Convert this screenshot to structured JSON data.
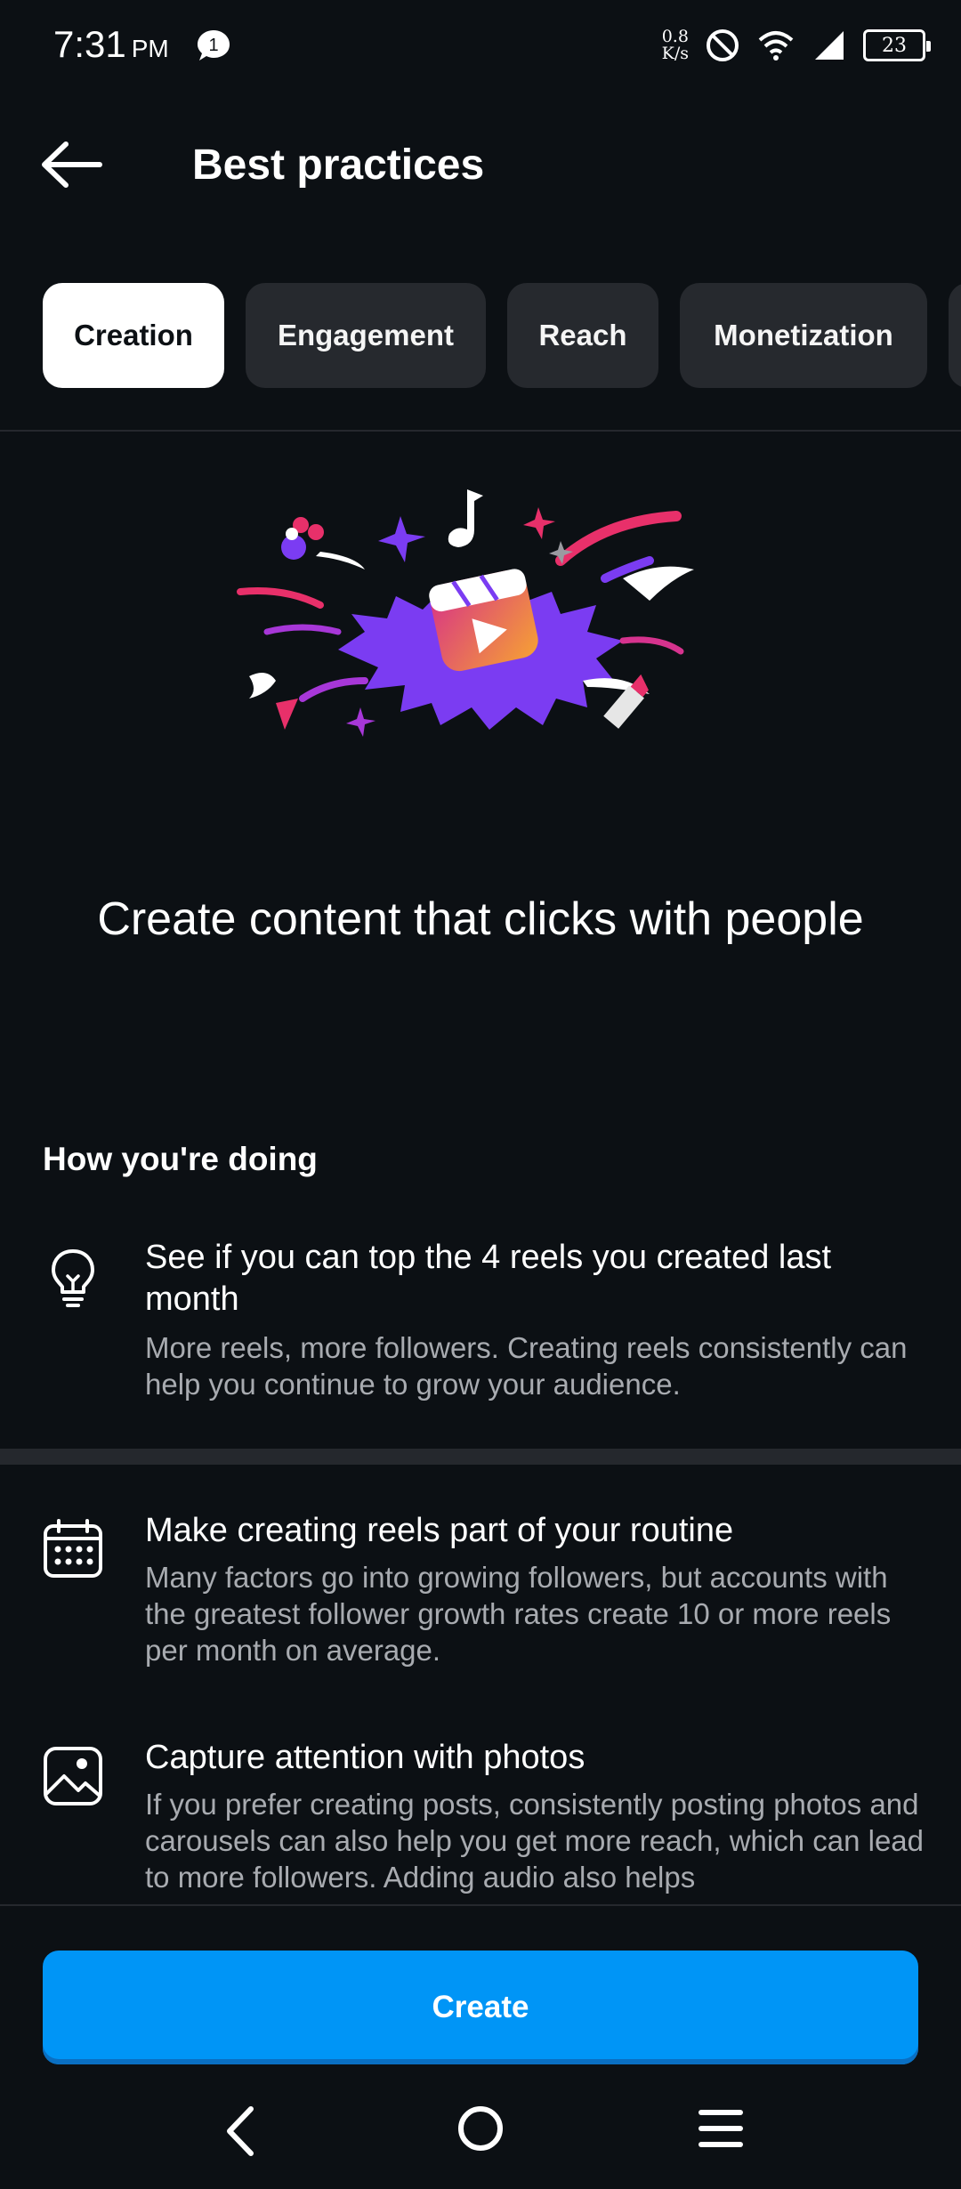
{
  "status_bar": {
    "time": "7:31",
    "ampm": "PM",
    "notification_count": "1",
    "net_speed_value": "0.8",
    "net_speed_unit": "K/s",
    "battery": "23"
  },
  "header": {
    "title": "Best practices"
  },
  "tabs": [
    {
      "label": "Creation",
      "active": true
    },
    {
      "label": "Engagement",
      "active": false
    },
    {
      "label": "Reach",
      "active": false
    },
    {
      "label": "Monetization",
      "active": false
    }
  ],
  "hero": {
    "headline": "Create content that clicks with people"
  },
  "section": {
    "title": "How you're doing"
  },
  "tips": [
    {
      "icon": "lightbulb-icon",
      "title": "See if you can top the 4 reels you created last month",
      "description": "More reels, more followers. Creating reels consistently can help you continue to grow your audience."
    },
    {
      "icon": "calendar-icon",
      "title": "Make creating reels part of your routine",
      "description": "Many factors go into growing followers, but accounts with the greatest follower growth rates create 10 or more reels per month on average."
    },
    {
      "icon": "photo-icon",
      "title": "Capture attention with photos",
      "description": "If you prefer creating posts, consistently posting photos and carousels can also help you get more reach, which can lead to more followers. Adding audio also helps"
    }
  ],
  "cta": {
    "label": "Create"
  },
  "colors": {
    "background": "#0c1014",
    "accent": "#0095f6",
    "tab_inactive": "#26292e",
    "secondary_text": "#a8abb0"
  }
}
